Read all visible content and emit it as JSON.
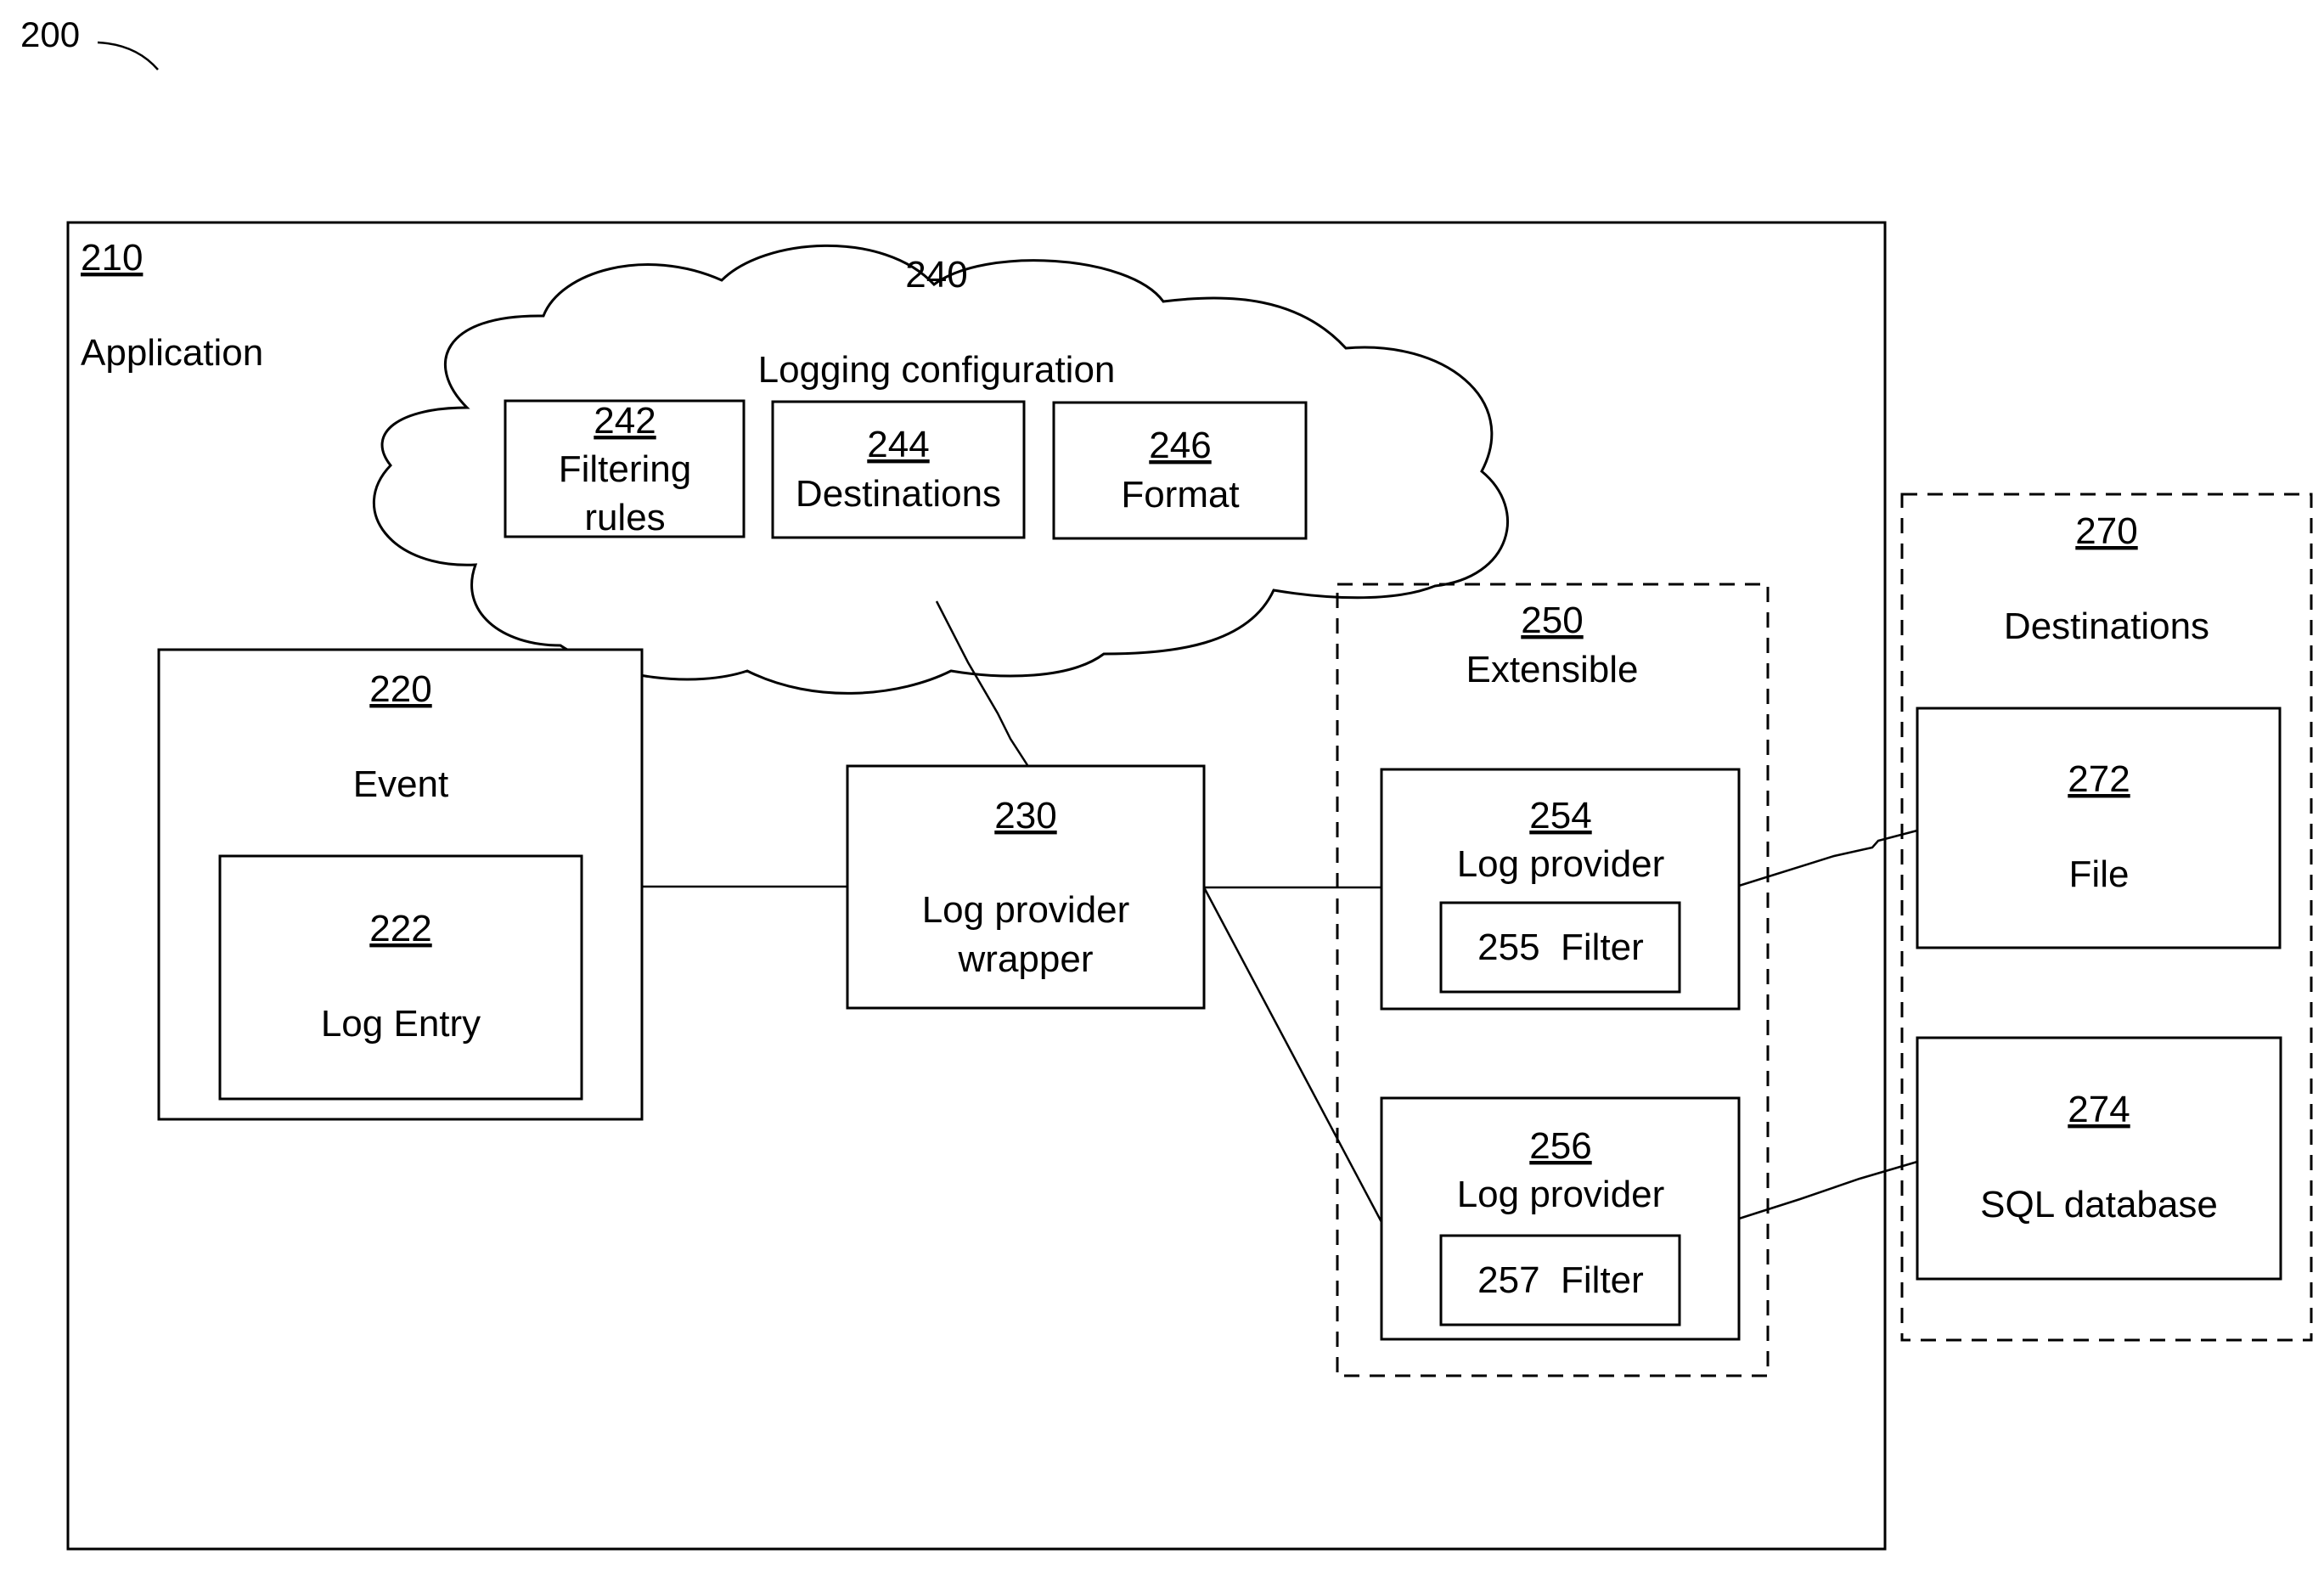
{
  "figure": {
    "label": "200"
  },
  "application": {
    "number": "210",
    "title": "Application"
  },
  "logging_configuration": {
    "number": "240",
    "title": "Logging configuration",
    "items": [
      {
        "number": "242",
        "lines": [
          "Filtering",
          "rules"
        ]
      },
      {
        "number": "244",
        "lines": [
          "Destinations"
        ]
      },
      {
        "number": "246",
        "lines": [
          "Format"
        ]
      }
    ]
  },
  "event": {
    "number": "220",
    "title": "Event",
    "log_entry": {
      "number": "222",
      "title": "Log Entry"
    }
  },
  "wrapper": {
    "number": "230",
    "lines": [
      "Log provider",
      "wrapper"
    ]
  },
  "extensible": {
    "number": "250",
    "title": "Extensible",
    "providers": [
      {
        "number": "254",
        "title": "Log provider",
        "filter": "255  Filter"
      },
      {
        "number": "256",
        "title": "Log provider",
        "filter": "257  Filter"
      }
    ]
  },
  "destinations": {
    "number": "270",
    "title": "Destinations",
    "items": [
      {
        "number": "272",
        "title": "File"
      },
      {
        "number": "274",
        "title": "SQL database"
      }
    ]
  }
}
